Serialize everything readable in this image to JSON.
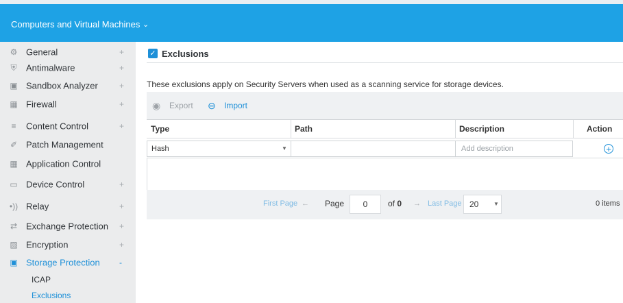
{
  "header": {
    "title": "Computers and Virtual Machines",
    "chevron_icon": "chevron-down-icon"
  },
  "sidebar": {
    "items": [
      {
        "label": "General",
        "icon": "gear-icon",
        "expand": "+"
      },
      {
        "label": "Antimalware",
        "icon": "shield-icon",
        "expand": "+"
      },
      {
        "label": "Sandbox Analyzer",
        "icon": "cube-icon",
        "expand": "+"
      },
      {
        "label": "Firewall",
        "icon": "firewall-icon",
        "expand": "+"
      },
      {
        "label": "Content Control",
        "icon": "content-icon",
        "expand": "+"
      },
      {
        "label": "Patch Management",
        "icon": "patch-icon",
        "expand": ""
      },
      {
        "label": "Application Control",
        "icon": "app-control-icon",
        "expand": ""
      },
      {
        "label": "Device Control",
        "icon": "device-icon",
        "expand": "+"
      },
      {
        "label": "Relay",
        "icon": "relay-icon",
        "expand": "+"
      },
      {
        "label": "Exchange Protection",
        "icon": "exchange-icon",
        "expand": "+"
      },
      {
        "label": "Encryption",
        "icon": "lock-icon",
        "expand": "+"
      },
      {
        "label": "Storage Protection",
        "icon": "storage-icon",
        "expand": "-"
      }
    ],
    "subitems": [
      {
        "label": "ICAP"
      },
      {
        "label": "Exclusions"
      }
    ]
  },
  "main": {
    "section_title": "Exclusions",
    "description": "These exclusions apply on Security Servers when used as a scanning service for storage devices.",
    "toolbar": {
      "export_label": "Export",
      "import_label": "Import"
    },
    "table": {
      "columns": [
        "Type",
        "Path",
        "Description",
        "Action"
      ],
      "new_row": {
        "type_value": "Hash",
        "path_value": "",
        "description_placeholder": "Add description"
      }
    },
    "pagination": {
      "first_page": "First Page",
      "arrow_left": "←",
      "page_label": "Page",
      "page_value": "0",
      "of_label": "of",
      "of_value": "0",
      "arrow_right": "→",
      "last_page": "Last Page",
      "per_page": "20",
      "items_count": "0 items"
    }
  },
  "colors": {
    "header_bg": "#1ea2e5",
    "accent": "#1e90d8",
    "sidebar_bg": "#ebeced",
    "toolbar_bg": "#eff1f3"
  }
}
